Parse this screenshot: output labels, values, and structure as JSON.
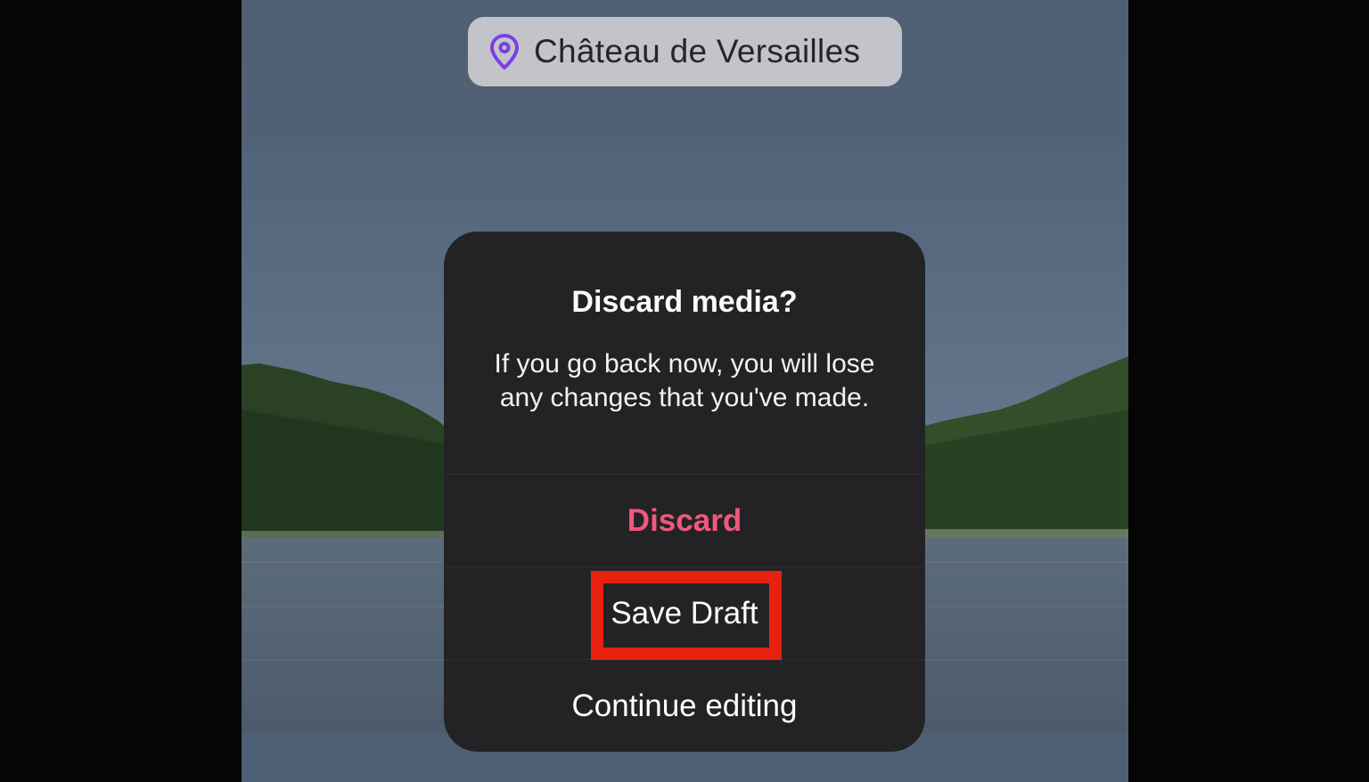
{
  "location": {
    "name": "Château de Versailles",
    "icon": "location-pin-icon",
    "icon_color": "#7b3fe4"
  },
  "dialog": {
    "title": "Discard media?",
    "message_line1": "If you go back now, you will lose",
    "message_line2": "any changes that you've made.",
    "buttons": {
      "discard": "Discard",
      "save_draft": "Save Draft",
      "continue_editing": "Continue editing"
    },
    "discard_color": "#f2577c"
  },
  "annotation": {
    "highlight_color": "#e8200f",
    "highlighted_button": "save_draft"
  }
}
